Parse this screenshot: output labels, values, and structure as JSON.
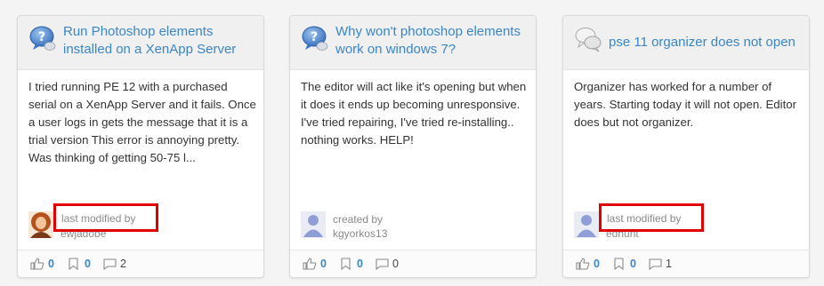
{
  "cards": [
    {
      "title": "Run Photoshop elements installed on a XenApp  Server",
      "body": "I tried  running PE 12  with a purchased serial on a XenApp Server and it fails. Once a user logs in gets the message that it is a trial version This error is annoying pretty. Was thinking of getting 50-75 l...",
      "author_label": "last modified by",
      "author_name": "ewjadobe",
      "likes": "0",
      "bookmarks": "0",
      "replies": "2",
      "icon": "question-bubble-icon"
    },
    {
      "title": "Why won't photoshop elements work on windows 7?",
      "body": "The editor will act like it's opening but when it does it ends up becoming unresponsive. I've tried repairing, I've tried re-installing.. nothing works. HELP!",
      "author_label": "created by",
      "author_name": "kgyorkos13",
      "likes": "0",
      "bookmarks": "0",
      "replies": "0",
      "icon": "question-bubble-icon"
    },
    {
      "title": "pse 11 organizer does not open",
      "body": "Organizer has worked for a number of years. Starting today it will not open. Editor does but not organizer.",
      "author_label": "last modified by",
      "author_name": "edhunt",
      "likes": "0",
      "bookmarks": "0",
      "replies": "1",
      "icon": "discussion-bubble-icon"
    }
  ],
  "colors": {
    "link": "#3a86c7",
    "highlight_border": "#e00000",
    "card_header": "#f0f0f0"
  }
}
